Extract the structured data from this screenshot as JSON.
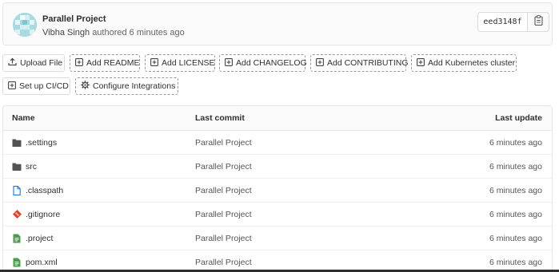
{
  "commit": {
    "title": "Parallel Project",
    "author": "Vibha Singh",
    "authored_text": "authored 6 minutes ago",
    "sha": "eed3148f"
  },
  "actions": [
    {
      "label": "Upload File",
      "icon": "upload-icon",
      "style": "solid"
    },
    {
      "label": "Add README",
      "icon": "plus-square-icon",
      "style": "dashed"
    },
    {
      "label": "Add LICENSE",
      "icon": "plus-square-icon",
      "style": "dashed"
    },
    {
      "label": "Add CHANGELOG",
      "icon": "plus-square-icon",
      "style": "dashed"
    },
    {
      "label": "Add CONTRIBUTING",
      "icon": "plus-square-icon",
      "style": "dashed"
    },
    {
      "label": "Add Kubernetes cluster",
      "icon": "plus-square-icon",
      "style": "dashed"
    },
    {
      "label": "Set up CI/CD",
      "icon": "plus-square-icon",
      "style": "solid"
    },
    {
      "label": "Configure Integrations",
      "icon": "gear-icon",
      "style": "dashed"
    }
  ],
  "table": {
    "headers": {
      "name": "Name",
      "last_commit": "Last commit",
      "last_update": "Last update"
    },
    "rows": [
      {
        "name": ".settings",
        "icon": "folder-icon",
        "commit": "Parallel Project",
        "updated": "6 minutes ago"
      },
      {
        "name": "src",
        "icon": "folder-icon",
        "commit": "Parallel Project",
        "updated": "6 minutes ago"
      },
      {
        "name": ".classpath",
        "icon": "file-icon",
        "commit": "Parallel Project",
        "updated": "6 minutes ago"
      },
      {
        "name": ".gitignore",
        "icon": "git-icon",
        "commit": "Parallel Project",
        "updated": "6 minutes ago"
      },
      {
        "name": ".project",
        "icon": "green-file-icon",
        "commit": "Parallel Project",
        "updated": "6 minutes ago"
      },
      {
        "name": "pom.xml",
        "icon": "green-file-icon",
        "commit": "Parallel Project",
        "updated": "6 minutes ago"
      }
    ]
  },
  "colors": {
    "folder": "#525252",
    "file": "#1f78d1",
    "git": "#e24329",
    "green_file": "#43a047",
    "avatar": "#a7dbe1"
  }
}
